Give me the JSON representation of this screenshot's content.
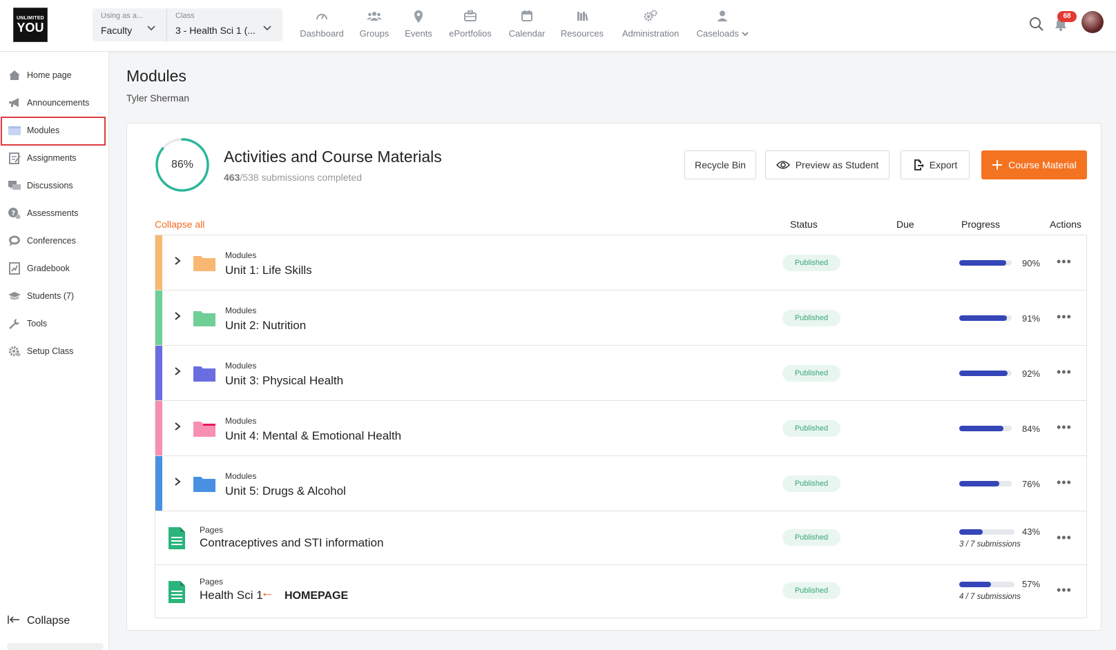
{
  "brand": {
    "logo_line1": "UNLIMITED",
    "logo_line2": "YOU"
  },
  "context": {
    "using_as_caption": "Using as a...",
    "using_as_value": "Faculty",
    "class_caption": "Class",
    "class_value": "3 - Health Sci 1 (..."
  },
  "nav": [
    {
      "label": "Dashboard",
      "icon": "gauge-icon"
    },
    {
      "label": "Groups",
      "icon": "group-icon"
    },
    {
      "label": "Events",
      "icon": "location-pin-icon"
    },
    {
      "label": "ePortfolios",
      "icon": "briefcase-icon"
    },
    {
      "label": "Calendar",
      "icon": "calendar-icon"
    },
    {
      "label": "Resources",
      "icon": "books-icon"
    },
    {
      "label": "Administration",
      "icon": "gears-icon"
    },
    {
      "label": "Caseloads",
      "icon": "user-icon"
    }
  ],
  "notifications": {
    "count": "68"
  },
  "sidebar": {
    "items": [
      {
        "label": "Home page",
        "icon": "home-icon"
      },
      {
        "label": "Announcements",
        "icon": "megaphone-icon"
      },
      {
        "label": "Modules",
        "icon": "folder-icon"
      },
      {
        "label": "Assignments",
        "icon": "assignment-icon"
      },
      {
        "label": "Discussions",
        "icon": "discussion-icon"
      },
      {
        "label": "Assessments",
        "icon": "assessment-icon"
      },
      {
        "label": "Conferences",
        "icon": "chat-bubble-icon"
      },
      {
        "label": "Gradebook",
        "icon": "gradebook-icon"
      },
      {
        "label": "Students (7)",
        "icon": "students-icon"
      },
      {
        "label": "Tools",
        "icon": "wrench-icon"
      },
      {
        "label": "Setup Class",
        "icon": "gear-icon"
      }
    ],
    "collapse_label": "Collapse"
  },
  "page": {
    "title": "Modules",
    "subtitle": "Tyler Sherman"
  },
  "summary": {
    "percent_label": "86%",
    "percent": 86,
    "title": "Activities and Course Materials",
    "completed": "463",
    "total_text": "/538 submissions completed"
  },
  "buttons": {
    "recycle": "Recycle Bin",
    "preview": "Preview as Student",
    "export": "Export",
    "course_material": "Course Material"
  },
  "table": {
    "collapse_all": "Collapse all",
    "headers": {
      "status": "Status",
      "due": "Due",
      "progress": "Progress",
      "actions": "Actions"
    },
    "rows": [
      {
        "type": "module",
        "category": "Modules",
        "name": "Unit 1: Life Skills",
        "status": "Published",
        "progress": 90,
        "progress_label": "90%",
        "color": "#f9b872"
      },
      {
        "type": "module",
        "category": "Modules",
        "name": "Unit 2: Nutrition",
        "status": "Published",
        "progress": 91,
        "progress_label": "91%",
        "color": "#6fcf97"
      },
      {
        "type": "module",
        "category": "Modules",
        "name": "Unit 3: Physical Health",
        "status": "Published",
        "progress": 92,
        "progress_label": "92%",
        "color": "#6a6de0"
      },
      {
        "type": "module",
        "category": "Modules",
        "name": "Unit 4: Mental & Emotional Health",
        "status": "Published",
        "progress": 84,
        "progress_label": "84%",
        "color": "#f78fb3"
      },
      {
        "type": "module",
        "category": "Modules",
        "name": "Unit 5: Drugs & Alcohol",
        "status": "Published",
        "progress": 76,
        "progress_label": "76%",
        "color": "#4a90e2"
      },
      {
        "type": "page",
        "category": "Pages",
        "name": "Contraceptives and STI information",
        "status": "Published",
        "progress": 43,
        "progress_label": "43%",
        "submissions": "3 / 7 submissions",
        "color": "#2bb57d"
      },
      {
        "type": "page",
        "category": "Pages",
        "name": "Health Sci 1",
        "status": "Published",
        "progress": 57,
        "progress_label": "57%",
        "submissions": "4 / 7 submissions",
        "note": "HOMEPAGE",
        "color": "#2bb57d"
      }
    ]
  }
}
